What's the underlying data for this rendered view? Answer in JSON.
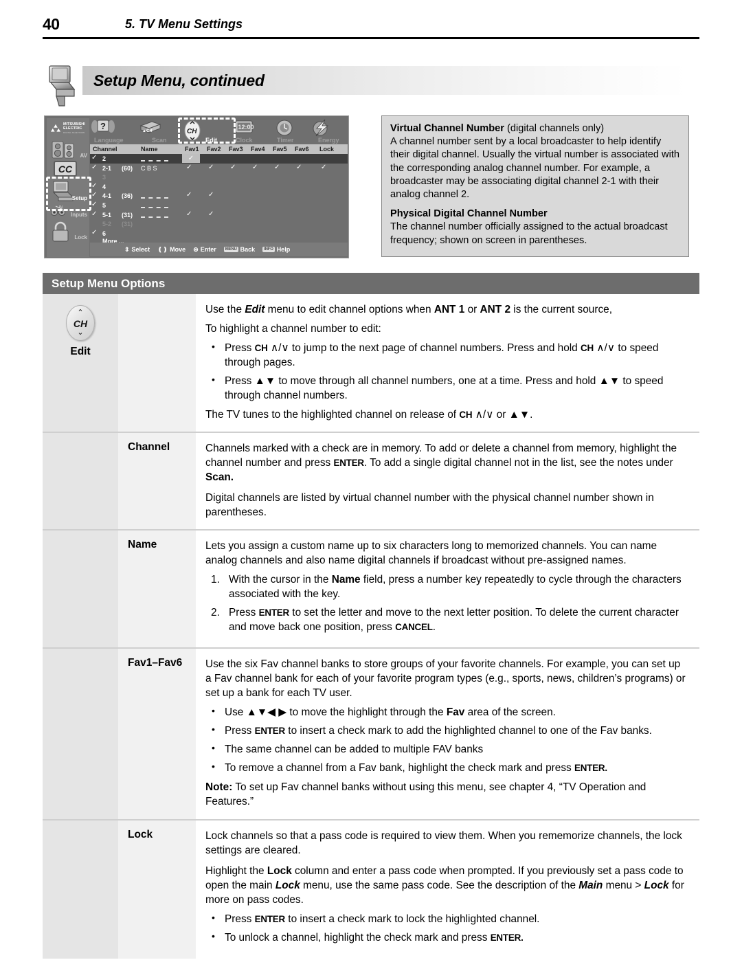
{
  "page": {
    "number": "40",
    "chapter": "5.  TV Menu Settings",
    "title": "Setup Menu, continued",
    "tv_icon": "tv-monitor-icon"
  },
  "tv_screenshot": {
    "brand": {
      "name": "MITSUBISHI",
      "name2": "ELECTRIC",
      "tagline": "DIGITAL TELEVISION"
    },
    "sidebar": [
      {
        "label": "AV",
        "icon": "speakers-icon",
        "selected": false
      },
      {
        "label": "CC",
        "icon": "closed-caption-icon",
        "selected": false
      },
      {
        "label": "Setup",
        "icon": "setup-monitor-icon",
        "selected": true
      },
      {
        "label": "Inputs",
        "icon": "inputs-jacks-icon",
        "selected": false
      },
      {
        "label": "Lock",
        "icon": "padlock-icon",
        "selected": false
      }
    ],
    "topnav": [
      {
        "label": "Language",
        "icon": "language-speech-icon",
        "selected": false
      },
      {
        "label": "Scan",
        "icon": "scan-channels-icon",
        "selected": false
      },
      {
        "label": "Edit",
        "icon": "ch-button-icon",
        "selected": true
      },
      {
        "label": "Clock",
        "icon": "clock-icon",
        "selected": false
      },
      {
        "label": "Timer",
        "icon": "timer-dial-icon",
        "selected": false
      },
      {
        "label": "Energy",
        "icon": "energy-bolt-icon",
        "selected": false
      }
    ],
    "columns": [
      "Channel",
      "Name",
      "Fav1",
      "Fav2",
      "Fav3",
      "Fav4",
      "Fav5",
      "Fav6",
      "Lock"
    ],
    "rows": [
      {
        "check": true,
        "channel": "2",
        "phys": "",
        "name": "------",
        "name_dashed": true,
        "favs": [
          true,
          false,
          false,
          false,
          false,
          false
        ],
        "lock": false,
        "selected": true,
        "dim": false,
        "fav1_highlight": true
      },
      {
        "check": true,
        "channel": "2-1",
        "phys": "(60)",
        "name": "C B S",
        "name_dashed": false,
        "favs": [
          true,
          true,
          true,
          true,
          true,
          true
        ],
        "lock": true,
        "selected": false,
        "dim": false,
        "fav1_highlight": false
      },
      {
        "check": false,
        "channel": "3",
        "phys": "",
        "name": "",
        "name_dashed": false,
        "favs": [
          false,
          false,
          false,
          false,
          false,
          false
        ],
        "lock": false,
        "selected": false,
        "dim": true,
        "fav1_highlight": false
      },
      {
        "check": true,
        "channel": "4",
        "phys": "",
        "name": "",
        "name_dashed": false,
        "favs": [
          false,
          false,
          false,
          false,
          false,
          false
        ],
        "lock": false,
        "selected": false,
        "dim": false,
        "fav1_highlight": false
      },
      {
        "check": true,
        "channel": "4-1",
        "phys": "(36)",
        "name": "------",
        "name_dashed": true,
        "favs": [
          true,
          true,
          false,
          false,
          false,
          false
        ],
        "lock": false,
        "selected": false,
        "dim": false,
        "fav1_highlight": false
      },
      {
        "check": true,
        "channel": "5",
        "phys": "",
        "name": "------",
        "name_dashed": true,
        "favs": [
          false,
          false,
          false,
          false,
          false,
          false
        ],
        "lock": false,
        "selected": false,
        "dim": false,
        "fav1_highlight": false
      },
      {
        "check": true,
        "channel": "5-1",
        "phys": "(31)",
        "name": "------",
        "name_dashed": true,
        "favs": [
          true,
          true,
          false,
          false,
          false,
          false
        ],
        "lock": false,
        "selected": false,
        "dim": false,
        "fav1_highlight": false
      },
      {
        "check": false,
        "channel": "5-2",
        "phys": "(31)",
        "name": "",
        "name_dashed": false,
        "favs": [
          false,
          false,
          false,
          false,
          false,
          false
        ],
        "lock": false,
        "selected": false,
        "dim": true,
        "fav1_highlight": false
      },
      {
        "check": true,
        "channel": "6",
        "phys": "",
        "name": "",
        "name_dashed": false,
        "favs": [
          false,
          false,
          false,
          false,
          false,
          false
        ],
        "lock": false,
        "selected": false,
        "dim": false,
        "fav1_highlight": false
      }
    ],
    "more_label": "More ...",
    "help_bar": [
      {
        "glyph": "select-updown-icon",
        "label": "Select"
      },
      {
        "glyph": "move-leftright-icon",
        "label": "Move"
      },
      {
        "glyph": "enter-button-icon",
        "label": "Enter"
      },
      {
        "glyph": "MENU",
        "label": "Back",
        "pill": true
      },
      {
        "glyph": "INFO",
        "label": "Help",
        "pill": true
      }
    ]
  },
  "infobox": {
    "p1_bold": "Virtual Channel Number",
    "p1_rest": " (digital channels only)",
    "p2": "A channel number sent by a local broadcaster to help identify their digital channel.  Usually the virtual number is associated with the corresponding analog channel number.  For example, a broadcaster may be associating digital channel 2-1 with their analog channel 2.",
    "p3_bold": "Physical Digital Channel Number",
    "p4": "The channel number officially assigned to the actual broadcast frequency; shown on screen in parentheses."
  },
  "section": {
    "header": "Setup Menu Options"
  },
  "options": {
    "edit": {
      "icon_label": "CH",
      "caption": "Edit",
      "intro1_a": "Use the ",
      "intro1_b": "Edit",
      "intro1_c": " menu to edit channel options when ",
      "intro1_d": "ANT 1",
      "intro1_e": " or ",
      "intro1_f": "ANT 2",
      "intro1_g": " is the current source,",
      "intro2": "To highlight a channel number to edit:",
      "b1_a": "Press ",
      "b1_key": "CH",
      "b1_b": " ∧/∨ to jump to the next page of channel numbers.  Press and hold ",
      "b1_key2": "CH",
      "b1_c": " ∧/∨ to speed through pages.",
      "b2_a": "Press ",
      "b2_arrows": "▲▼",
      "b2_b": " to move through all channel numbers, one at a time.  Press and hold ",
      "b2_arrows2": "▲▼",
      "b2_c": " to speed through channel numbers.",
      "outro_a": "The TV tunes to the highlighted channel on release of ",
      "outro_key": "CH",
      "outro_b": " ∧/∨ or  ",
      "outro_arrows": "▲▼",
      "outro_c": "."
    },
    "channel": {
      "label": "Channel",
      "p1_a": "Channels marked with a check are in memory.  To add or delete a channel from memory, highlight the channel number and press ",
      "p1_key": "ENTER",
      "p1_b": ".  To add a single digital channel not in the list, see the notes under ",
      "p1_bold": "Scan.",
      "p2": "Digital channels are listed by virtual channel number with the physical channel number shown in parentheses."
    },
    "name": {
      "label": "Name",
      "p1": "Lets you assign a custom name up to six characters long to memorized channels.  You can name analog channels and also name digital channels if broadcast without pre-assigned names.",
      "n1_a": "With the cursor in the ",
      "n1_bold": "Name",
      "n1_b": " field, press a number key repeatedly to cycle through the characters associated with the key.",
      "n2_a": "Press ",
      "n2_key": "ENTER",
      "n2_b": " to set the letter and move to the next letter position.  To delete the current character and move back one position, press ",
      "n2_key2": "CANCEL",
      "n2_c": "."
    },
    "fav": {
      "label": "Fav1–Fav6",
      "p1": "Use the six Fav channel banks to store groups of your favorite channels.  For example, you can set up a Fav channel bank for each of your favorite program types (e.g., sports, news, children’s programs) or set up a bank for each TV user.",
      "b1_a": "Use ",
      "b1_arrows": "▲▼◀ ▶",
      "b1_b": " to move the highlight through the ",
      "b1_bold": "Fav",
      "b1_c": " area of the screen.",
      "b2_a": "Press ",
      "b2_key": "ENTER",
      "b2_b": " to insert a check mark to add the highlighted channel to one of the Fav banks.",
      "b3": "The same channel can be added to multiple FAV banks",
      "b4_a": "To remove a channel from a Fav bank, highlight the check mark and press ",
      "b4_key": "ENTER.",
      "note_label": "Note:",
      "note_text": "   To set up Fav channel banks without using this menu, see chapter 4, “TV Operation and Features.”"
    },
    "lock": {
      "label": "Lock",
      "p1": "Lock channels so that a pass code is required to view them.  When you rememorize channels, the lock settings are cleared.",
      "p2_a": "Highlight the ",
      "p2_bold": "Lock",
      "p2_b": " column and enter a pass code when prompted.  If you previously set a pass code to open the main ",
      "p2_ital": "Lock",
      "p2_c": " menu, use the same pass code.  See the description of the ",
      "p2_ital2": "Main",
      "p2_d": " menu > ",
      "p2_ital3": "Lock",
      "p2_e": " for more on pass codes.",
      "b1_a": "Press ",
      "b1_key": "ENTER",
      "b1_b": " to insert a check mark to lock the highlighted channel.",
      "b2_a": "To unlock a channel, highlight the check mark and press ",
      "b2_key": "ENTER."
    }
  },
  "colors": {
    "section_header_bg": "#6d6d6d",
    "label_col_bg": "#f1f1f1",
    "icon_col_bg": "#e5e5e5",
    "infobox_bg": "#d9d9d9",
    "tv_bg": "#6f6f6f"
  }
}
